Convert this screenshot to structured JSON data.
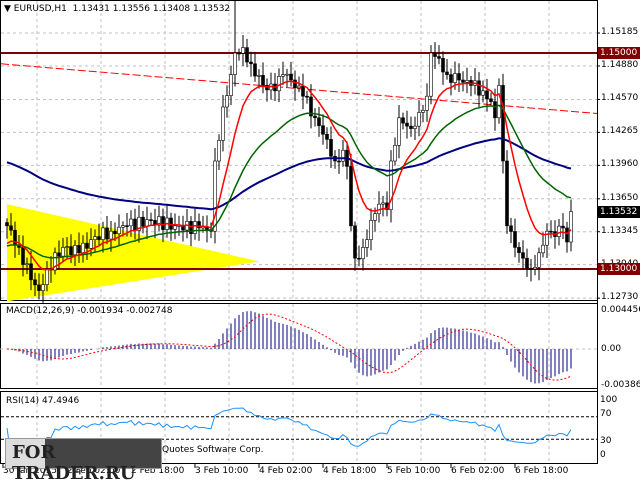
{
  "header": {
    "symbol": "EURUSD,H1",
    "open": "1.13431",
    "high": "1.13556",
    "low": "1.13408",
    "close": "1.13532"
  },
  "price_axis": {
    "labels": [
      "1.15185",
      "1.14880",
      "1.14570",
      "1.14265",
      "1.13960",
      "1.13650",
      "1.13345",
      "1.13040",
      "1.12730"
    ],
    "tags": [
      {
        "text": "1.15000",
        "color": "#800000"
      },
      {
        "text": "1.13532",
        "color": "#000000"
      },
      {
        "text": "1.13000",
        "color": "#800000"
      }
    ]
  },
  "macd": {
    "title": "MACD(12,26,9) -0.001934 -0.002748",
    "labels": [
      "0.004456",
      "0.00",
      "-0.003864"
    ]
  },
  "rsi": {
    "title": "RSI(14) 47.4946",
    "labels": [
      "100",
      "70",
      "30",
      "0"
    ]
  },
  "time_axis": [
    "30 Jan 2015",
    "2 Feb 02:00",
    "2 Feb 18:00",
    "3 Feb 10:00",
    "4 Feb 02:00",
    "4 Feb 18:00",
    "5 Feb 10:00",
    "6 Feb 02:00",
    "6 Feb 18:00"
  ],
  "watermark": {
    "logo": "FOR TRADER.RU",
    "copyright": "MetaTrader 4, © 2001-2014, MetaQuotes Software Corp."
  },
  "colors": {
    "bg": "#ffffff",
    "level": "#800000",
    "trend": "#ff0000",
    "ma_fast": "#ff0000",
    "ma_mid": "#006400",
    "ma_slow": "#000080",
    "triangle": "#ffff00",
    "macd_hist": "#000080",
    "macd_signal": "#ff0000",
    "rsi": "#1e90ff"
  },
  "chart_data": {
    "type": "candlestick",
    "symbol": "EURUSD",
    "timeframe": "H1",
    "ylim": [
      1.1273,
      1.1555
    ],
    "levels": [
      1.15,
      1.13
    ],
    "last_price": 1.13532,
    "price_path": [
      [
        0,
        1.134
      ],
      [
        3,
        1.132
      ],
      [
        6,
        1.129
      ],
      [
        8,
        1.128
      ],
      [
        10,
        1.13
      ],
      [
        14,
        1.132
      ],
      [
        18,
        1.1315
      ],
      [
        22,
        1.133
      ],
      [
        26,
        1.1335
      ],
      [
        30,
        1.134
      ],
      [
        36,
        1.1345
      ],
      [
        42,
        1.134
      ],
      [
        48,
        1.1338
      ],
      [
        51,
        1.1335
      ],
      [
        52,
        1.14
      ],
      [
        54,
        1.145
      ],
      [
        56,
        1.148
      ],
      [
        57,
        1.15
      ],
      [
        59,
        1.1505
      ],
      [
        61,
        1.149
      ],
      [
        64,
        1.147
      ],
      [
        67,
        1.1465
      ],
      [
        69,
        1.148
      ],
      [
        71,
        1.1475
      ],
      [
        74,
        1.146
      ],
      [
        77,
        1.144
      ],
      [
        80,
        1.142
      ],
      [
        82,
        1.14
      ],
      [
        84,
        1.141
      ],
      [
        85,
        1.1395
      ],
      [
        86,
        1.134
      ],
      [
        87,
        1.131
      ],
      [
        89,
        1.132
      ],
      [
        91,
        1.1345
      ],
      [
        93,
        1.136
      ],
      [
        95,
        1.1355
      ],
      [
        96,
        1.14
      ],
      [
        98,
        1.144
      ],
      [
        101,
        1.143
      ],
      [
        103,
        1.1445
      ],
      [
        105,
        1.146
      ],
      [
        106,
        1.15
      ],
      [
        108,
        1.1495
      ],
      [
        110,
        1.148
      ],
      [
        113,
        1.1475
      ],
      [
        116,
        1.147
      ],
      [
        119,
        1.1465
      ],
      [
        121,
        1.1455
      ],
      [
        122,
        1.144
      ],
      [
        123,
        1.147
      ],
      [
        124,
        1.14
      ],
      [
        125,
        1.134
      ],
      [
        127,
        1.132
      ],
      [
        129,
        1.131
      ],
      [
        131,
        1.13
      ],
      [
        133,
        1.1315
      ],
      [
        135,
        1.1335
      ],
      [
        137,
        1.133
      ],
      [
        139,
        1.1338
      ],
      [
        140,
        1.1325
      ],
      [
        141,
        1.13532
      ]
    ],
    "indicators": {
      "ma_fast_period": 10,
      "ma_mid_period": 30,
      "ma_slow_period": 100,
      "macd": {
        "fast": 12,
        "slow": 26,
        "signal": 9,
        "value": -0.001934,
        "signal_value": -0.002748,
        "ylim": [
          -0.003864,
          0.004456
        ]
      },
      "rsi": {
        "period": 14,
        "value": 47.4946,
        "levels": [
          70,
          30
        ],
        "ylim": [
          0,
          100
        ]
      }
    },
    "trendline": {
      "from": [
        0,
        1.149
      ],
      "to": [
        148,
        1.1444
      ]
    },
    "triangle": {
      "points": [
        [
          0,
          1.136
        ],
        [
          63,
          1.1307
        ],
        [
          0,
          1.127
        ]
      ]
    }
  }
}
